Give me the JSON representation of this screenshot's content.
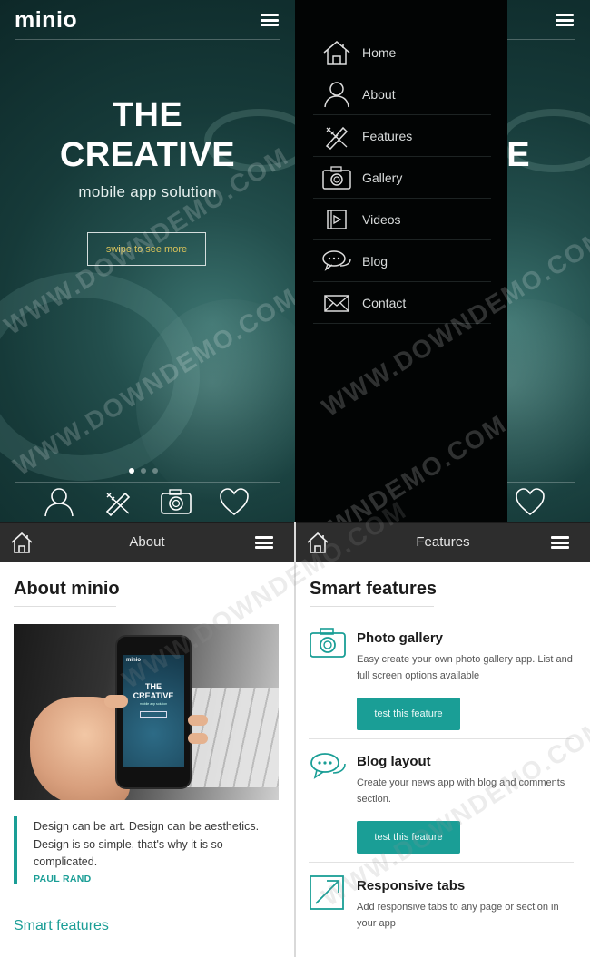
{
  "brand": {
    "logo": "minio",
    "accent": "#1a9e96"
  },
  "hero": {
    "title_line1": "THE",
    "title_line2": "CREATIVE",
    "subtitle": "mobile app solution",
    "swipe_label": "swipe to see more",
    "slide_dots": 3,
    "active_dot": 1,
    "bottom_icons": [
      "user-icon",
      "pencil-ruler-icon",
      "camera-icon",
      "heart-icon"
    ]
  },
  "menu": {
    "items": [
      {
        "label": "Home",
        "icon": "home-icon"
      },
      {
        "label": "About",
        "icon": "user-icon"
      },
      {
        "label": "Features",
        "icon": "pencil-ruler-icon"
      },
      {
        "label": "Gallery",
        "icon": "camera-icon"
      },
      {
        "label": "Videos",
        "icon": "film-icon"
      },
      {
        "label": "Blog",
        "icon": "speech-bubbles-icon"
      },
      {
        "label": "Contact",
        "icon": "envelope-icon"
      }
    ]
  },
  "about": {
    "header_title": "About",
    "heading": "About minio",
    "phone_screen": {
      "logo": "minio",
      "title_line1": "THE",
      "title_line2": "CREATIVE",
      "subtitle": "mobile app solution"
    },
    "quote": "Design can be art. Design can be aesthetics. Design is so simple, that's why it is so complicated.",
    "author": "PAUL RAND",
    "link": "Smart features"
  },
  "features": {
    "header_title": "Features",
    "heading": "Smart features",
    "items": [
      {
        "title": "Photo gallery",
        "desc": "Easy create your own photo gallery app. List and full screen options available",
        "button": "test this feature",
        "icon": "camera-icon"
      },
      {
        "title": "Blog layout",
        "desc": "Create your news app with blog and comments section.",
        "button": "test this feature",
        "icon": "speech-bubbles-icon"
      },
      {
        "title": "Responsive tabs",
        "desc": "Add responsive tabs to any page or section in your app",
        "icon": "expand-arrow-icon"
      }
    ]
  },
  "watermark": "WWW.DOWNDEMO.COM"
}
